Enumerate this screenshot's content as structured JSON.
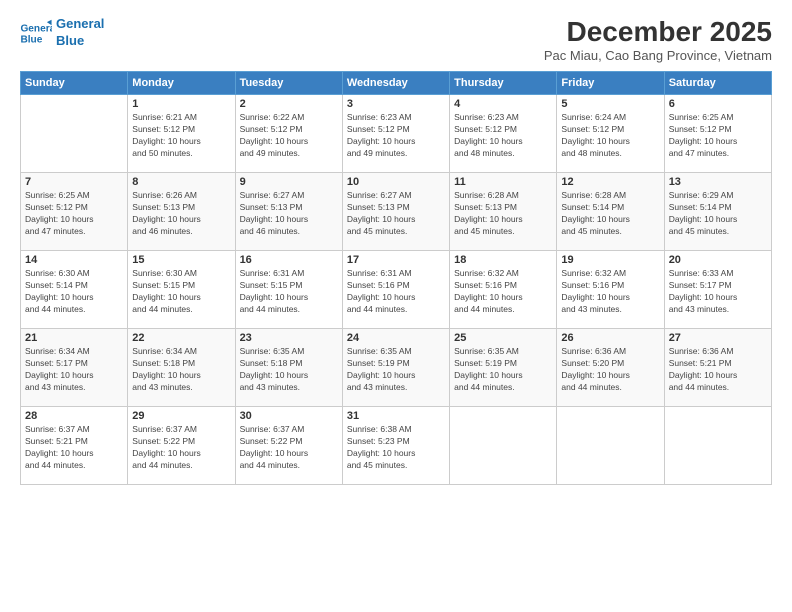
{
  "logo": {
    "line1": "General",
    "line2": "Blue"
  },
  "title": "December 2025",
  "subtitle": "Pac Miau, Cao Bang Province, Vietnam",
  "headers": [
    "Sunday",
    "Monday",
    "Tuesday",
    "Wednesday",
    "Thursday",
    "Friday",
    "Saturday"
  ],
  "weeks": [
    [
      {
        "day": "",
        "info": ""
      },
      {
        "day": "1",
        "info": "Sunrise: 6:21 AM\nSunset: 5:12 PM\nDaylight: 10 hours\nand 50 minutes."
      },
      {
        "day": "2",
        "info": "Sunrise: 6:22 AM\nSunset: 5:12 PM\nDaylight: 10 hours\nand 49 minutes."
      },
      {
        "day": "3",
        "info": "Sunrise: 6:23 AM\nSunset: 5:12 PM\nDaylight: 10 hours\nand 49 minutes."
      },
      {
        "day": "4",
        "info": "Sunrise: 6:23 AM\nSunset: 5:12 PM\nDaylight: 10 hours\nand 48 minutes."
      },
      {
        "day": "5",
        "info": "Sunrise: 6:24 AM\nSunset: 5:12 PM\nDaylight: 10 hours\nand 48 minutes."
      },
      {
        "day": "6",
        "info": "Sunrise: 6:25 AM\nSunset: 5:12 PM\nDaylight: 10 hours\nand 47 minutes."
      }
    ],
    [
      {
        "day": "7",
        "info": "Sunrise: 6:25 AM\nSunset: 5:12 PM\nDaylight: 10 hours\nand 47 minutes."
      },
      {
        "day": "8",
        "info": "Sunrise: 6:26 AM\nSunset: 5:13 PM\nDaylight: 10 hours\nand 46 minutes."
      },
      {
        "day": "9",
        "info": "Sunrise: 6:27 AM\nSunset: 5:13 PM\nDaylight: 10 hours\nand 46 minutes."
      },
      {
        "day": "10",
        "info": "Sunrise: 6:27 AM\nSunset: 5:13 PM\nDaylight: 10 hours\nand 45 minutes."
      },
      {
        "day": "11",
        "info": "Sunrise: 6:28 AM\nSunset: 5:13 PM\nDaylight: 10 hours\nand 45 minutes."
      },
      {
        "day": "12",
        "info": "Sunrise: 6:28 AM\nSunset: 5:14 PM\nDaylight: 10 hours\nand 45 minutes."
      },
      {
        "day": "13",
        "info": "Sunrise: 6:29 AM\nSunset: 5:14 PM\nDaylight: 10 hours\nand 45 minutes."
      }
    ],
    [
      {
        "day": "14",
        "info": "Sunrise: 6:30 AM\nSunset: 5:14 PM\nDaylight: 10 hours\nand 44 minutes."
      },
      {
        "day": "15",
        "info": "Sunrise: 6:30 AM\nSunset: 5:15 PM\nDaylight: 10 hours\nand 44 minutes."
      },
      {
        "day": "16",
        "info": "Sunrise: 6:31 AM\nSunset: 5:15 PM\nDaylight: 10 hours\nand 44 minutes."
      },
      {
        "day": "17",
        "info": "Sunrise: 6:31 AM\nSunset: 5:16 PM\nDaylight: 10 hours\nand 44 minutes."
      },
      {
        "day": "18",
        "info": "Sunrise: 6:32 AM\nSunset: 5:16 PM\nDaylight: 10 hours\nand 44 minutes."
      },
      {
        "day": "19",
        "info": "Sunrise: 6:32 AM\nSunset: 5:16 PM\nDaylight: 10 hours\nand 43 minutes."
      },
      {
        "day": "20",
        "info": "Sunrise: 6:33 AM\nSunset: 5:17 PM\nDaylight: 10 hours\nand 43 minutes."
      }
    ],
    [
      {
        "day": "21",
        "info": "Sunrise: 6:34 AM\nSunset: 5:17 PM\nDaylight: 10 hours\nand 43 minutes."
      },
      {
        "day": "22",
        "info": "Sunrise: 6:34 AM\nSunset: 5:18 PM\nDaylight: 10 hours\nand 43 minutes."
      },
      {
        "day": "23",
        "info": "Sunrise: 6:35 AM\nSunset: 5:18 PM\nDaylight: 10 hours\nand 43 minutes."
      },
      {
        "day": "24",
        "info": "Sunrise: 6:35 AM\nSunset: 5:19 PM\nDaylight: 10 hours\nand 43 minutes."
      },
      {
        "day": "25",
        "info": "Sunrise: 6:35 AM\nSunset: 5:19 PM\nDaylight: 10 hours\nand 44 minutes."
      },
      {
        "day": "26",
        "info": "Sunrise: 6:36 AM\nSunset: 5:20 PM\nDaylight: 10 hours\nand 44 minutes."
      },
      {
        "day": "27",
        "info": "Sunrise: 6:36 AM\nSunset: 5:21 PM\nDaylight: 10 hours\nand 44 minutes."
      }
    ],
    [
      {
        "day": "28",
        "info": "Sunrise: 6:37 AM\nSunset: 5:21 PM\nDaylight: 10 hours\nand 44 minutes."
      },
      {
        "day": "29",
        "info": "Sunrise: 6:37 AM\nSunset: 5:22 PM\nDaylight: 10 hours\nand 44 minutes."
      },
      {
        "day": "30",
        "info": "Sunrise: 6:37 AM\nSunset: 5:22 PM\nDaylight: 10 hours\nand 44 minutes."
      },
      {
        "day": "31",
        "info": "Sunrise: 6:38 AM\nSunset: 5:23 PM\nDaylight: 10 hours\nand 45 minutes."
      },
      {
        "day": "",
        "info": ""
      },
      {
        "day": "",
        "info": ""
      },
      {
        "day": "",
        "info": ""
      }
    ]
  ]
}
